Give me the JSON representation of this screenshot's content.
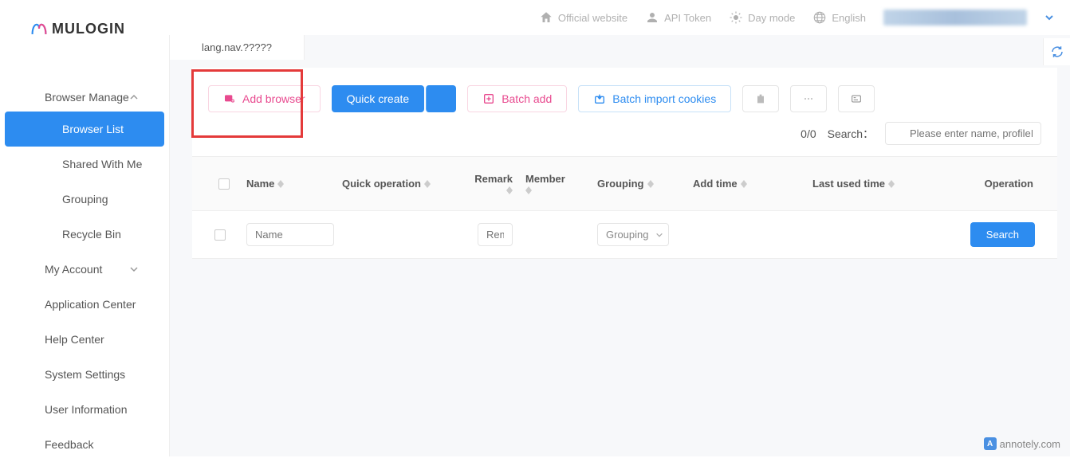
{
  "brand": "MULOGIN",
  "topbar": {
    "official_website": "Official website",
    "api_token": "API Token",
    "day_mode": "Day mode",
    "language": "English"
  },
  "sidebar": {
    "browser_manage": "Browser Manage",
    "browser_list": "Browser List",
    "shared_with_me": "Shared With Me",
    "grouping": "Grouping",
    "recycle_bin": "Recycle Bin",
    "my_account": "My Account",
    "application_center": "Application Center",
    "help_center": "Help Center",
    "system_settings": "System Settings",
    "user_information": "User Information",
    "feedback": "Feedback"
  },
  "tab": {
    "label": "lang.nav.?????"
  },
  "toolbar": {
    "add_browser": "Add browser",
    "quick_create": "Quick create",
    "batch_add": "Batch add",
    "batch_import_cookies": "Batch import cookies"
  },
  "search": {
    "count": "0/0",
    "label": "Search：",
    "placeholder": "Please enter name, profileID"
  },
  "columns": {
    "name": "Name",
    "quick_operation": "Quick operation",
    "remark": "Remark",
    "member": "Member",
    "grouping": "Grouping",
    "add_time": "Add time",
    "last_used_time": "Last used time",
    "operation": "Operation"
  },
  "filter_row": {
    "name_placeholder": "Name",
    "remark_placeholder": "Remark",
    "grouping_placeholder": "Grouping",
    "search_button": "Search"
  },
  "watermark": "annotely.com"
}
